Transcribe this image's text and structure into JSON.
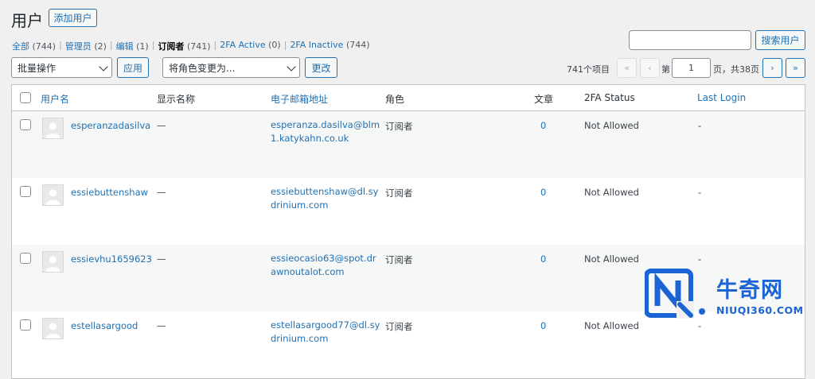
{
  "page": {
    "title": "用户",
    "add_button": "添加用户"
  },
  "filters": [
    {
      "label": "全部",
      "count": "(744)",
      "current": false
    },
    {
      "label": "管理员",
      "count": "(2)",
      "current": false
    },
    {
      "label": "编辑",
      "count": "(1)",
      "current": false
    },
    {
      "label": "订阅者",
      "count": "(741)",
      "current": true
    },
    {
      "label": "2FA Active",
      "count": "(0)",
      "current": false
    },
    {
      "label": "2FA Inactive",
      "count": "(744)",
      "current": false
    }
  ],
  "search": {
    "value": "",
    "button": "搜索用户"
  },
  "bulk": {
    "selected": "批量操作",
    "apply": "应用"
  },
  "role_change": {
    "selected": "将角色变更为...",
    "button": "更改"
  },
  "pagination": {
    "items": "741个项目",
    "first": "«",
    "prev": "‹",
    "page_prefix": "第",
    "current_page": "1",
    "page_suffix": "页，共38页",
    "next": "›",
    "last": "»"
  },
  "table": {
    "columns": {
      "username": "用户名",
      "display_name": "显示名称",
      "email": "电子邮箱地址",
      "role": "角色",
      "posts": "文章",
      "twofa": "2FA Status",
      "last_login": "Last Login"
    },
    "rows": [
      {
        "username": "esperanzadasilva",
        "display_name": "—",
        "email": "esperanza.dasilva@blm1.katykahn.co.uk",
        "role": "订阅者",
        "posts": "0",
        "twofa": "Not Allowed",
        "last_login": "-"
      },
      {
        "username": "essiebuttenshaw",
        "display_name": "—",
        "email": "essiebuttenshaw@dl.sydrinium.com",
        "role": "订阅者",
        "posts": "0",
        "twofa": "Not Allowed",
        "last_login": "-"
      },
      {
        "username": "essievhu1659623",
        "display_name": "—",
        "email": "essieocasio63@spot.drawnoutalot.com",
        "role": "订阅者",
        "posts": "0",
        "twofa": "Not Allowed",
        "last_login": "-"
      },
      {
        "username": "estellasargood",
        "display_name": "—",
        "email": "estellasargood77@dl.sydrinium.com",
        "role": "订阅者",
        "posts": "0",
        "twofa": "Not Allowed",
        "last_login": "-"
      }
    ]
  },
  "watermark": {
    "brand": "牛奇网",
    "url": "NIUQI360.COM",
    "colors": {
      "blue": "#1a64d6"
    }
  }
}
